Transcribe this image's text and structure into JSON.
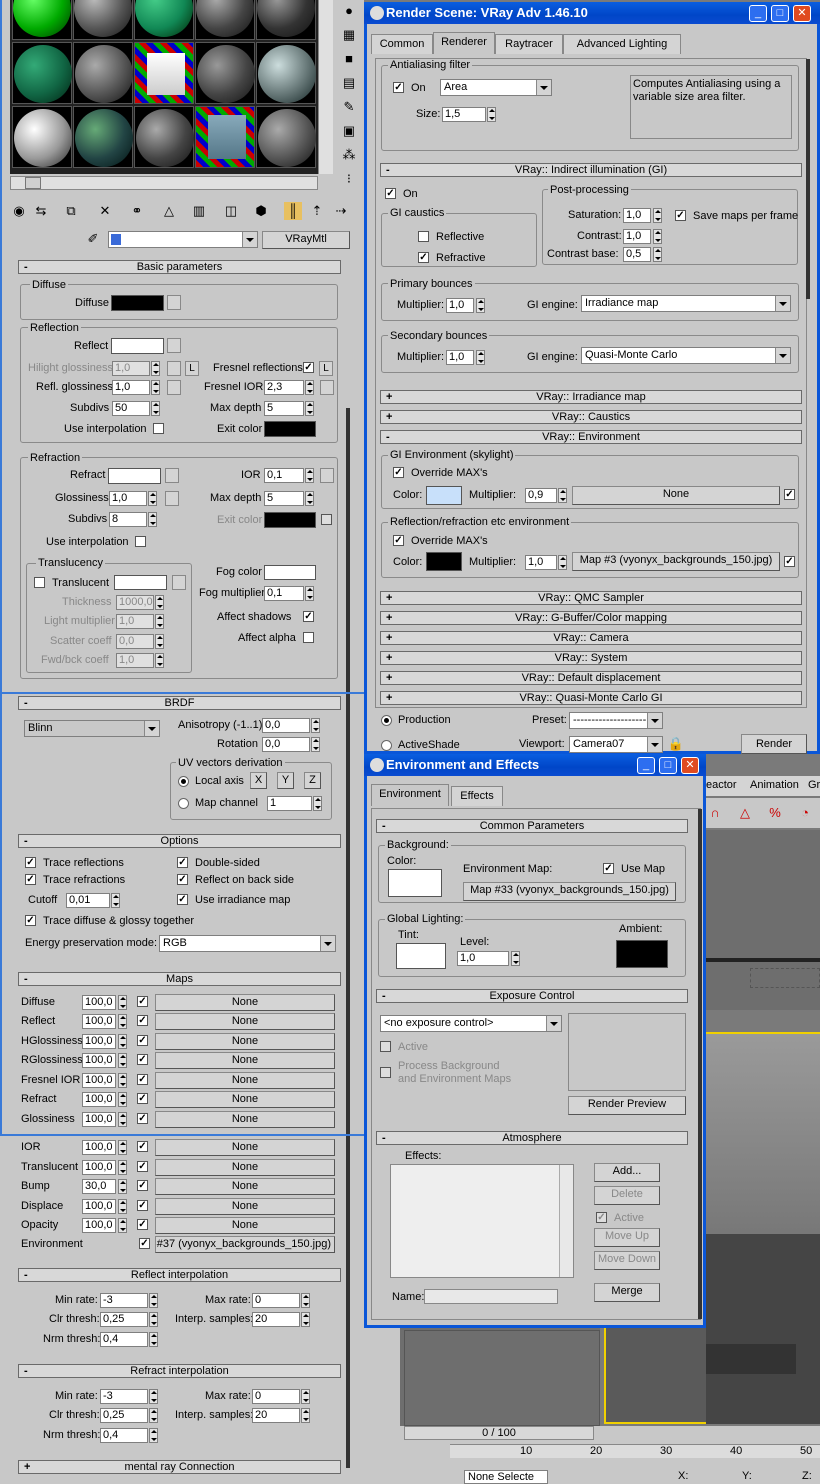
{
  "colors": {
    "panel": "#c8c8c8",
    "titlebar": "#0a56d8",
    "selection_line": "#3a7ad8",
    "viewport": "#6e6e6e"
  },
  "icons": [
    "sphere-icon",
    "checker-icon",
    "cube-icon",
    "color-icon",
    "brush-icon",
    "video-icon",
    "options-icon",
    "select-by-mtl-icon",
    "get-material-icon",
    "put-to-scene-icon",
    "assign-icon",
    "reset-icon",
    "copy-icon",
    "unique-icon",
    "library-icon",
    "id-icon",
    "show-map-icon",
    "show-end-icon",
    "go-parent-icon",
    "go-sibling-icon",
    "pick-icon"
  ],
  "mat_editor": {
    "type_button": "VRayMtl",
    "basic": {
      "title": "Basic parameters",
      "diffuse_group": "Diffuse",
      "diffuse_label": "Diffuse",
      "reflection_group": "Reflection",
      "reflect_label": "Reflect",
      "hilight_label": "Hilight glossiness",
      "hilight_value": "1,0",
      "l_button": "L",
      "fresnel_label": "Fresnel reflections",
      "fresnel_l": "L",
      "refl_gloss_label": "Refl. glossiness",
      "refl_gloss_value": "1,0",
      "fresnel_ior_label": "Fresnel IOR",
      "fresnel_ior_value": "2,3",
      "subdivs_label": "Subdivs",
      "subdivs_value": "50",
      "max_depth_label": "Max depth",
      "max_depth_value": "5",
      "use_interp_label": "Use interpolation",
      "exit_color_label": "Exit color",
      "refraction_group": "Refraction",
      "refract_label": "Refract",
      "ior_label": "IOR",
      "ior_value": "0,1",
      "gloss_label": "Glossiness",
      "gloss_value": "1,0",
      "rmax_depth_label": "Max depth",
      "rmax_depth_value": "5",
      "rsubdivs_label": "Subdivs",
      "rsubdivs_value": "8",
      "rexit_label": "Exit color",
      "ruse_interp_label": "Use interpolation",
      "transl_group": "Translucency",
      "transl_label": "Translucent",
      "thickness_label": "Thickness",
      "thickness_value": "1000,0",
      "light_mult_label": "Light multiplier",
      "light_mult_value": "1,0",
      "scatter_label": "Scatter coeff",
      "scatter_value": "0,0",
      "fwd_label": "Fwd/bck coeff",
      "fwd_value": "1,0",
      "fog_color_label": "Fog color",
      "fog_mult_label": "Fog multiplier",
      "fog_mult_value": "0,1",
      "affect_shadows_label": "Affect shadows",
      "affect_alpha_label": "Affect alpha"
    },
    "brdf": {
      "title": "BRDF",
      "type": "Blinn",
      "aniso_label": "Anisotropy (-1..1)",
      "aniso_value": "0,0",
      "rotation_label": "Rotation",
      "rotation_value": "0,0",
      "uv_group": "UV vectors derivation",
      "local_axis": "Local axis",
      "x": "X",
      "y": "Y",
      "z": "Z",
      "map_channel": "Map channel",
      "map_channel_value": "1"
    },
    "options": {
      "title": "Options",
      "trace_refl": "Trace reflections",
      "double_sided": "Double-sided",
      "trace_refr": "Trace refractions",
      "reflect_back": "Reflect on back side",
      "cutoff_label": "Cutoff",
      "cutoff_value": "0,01",
      "use_irr": "Use irradiance map",
      "trace_diffuse": "Trace diffuse & glossy together",
      "energy_label": "Energy preservation mode:",
      "energy_value": "RGB"
    },
    "maps": {
      "title": "Maps",
      "rows": [
        {
          "name": "Diffuse",
          "amount": "100,0",
          "map": "None"
        },
        {
          "name": "Reflect",
          "amount": "100,0",
          "map": "None"
        },
        {
          "name": "HGlossiness",
          "amount": "100,0",
          "map": "None"
        },
        {
          "name": "RGlossiness",
          "amount": "100,0",
          "map": "None"
        },
        {
          "name": "Fresnel IOR",
          "amount": "100,0",
          "map": "None"
        },
        {
          "name": "Refract",
          "amount": "100,0",
          "map": "None"
        },
        {
          "name": "Glossiness",
          "amount": "100,0",
          "map": "None"
        },
        {
          "name": "IOR",
          "amount": "100,0",
          "map": "None"
        },
        {
          "name": "Translucent",
          "amount": "100,0",
          "map": "None"
        },
        {
          "name": "Bump",
          "amount": "30,0",
          "map": "None"
        },
        {
          "name": "Displace",
          "amount": "100,0",
          "map": "None"
        },
        {
          "name": "Opacity",
          "amount": "100,0",
          "map": "None"
        }
      ],
      "environment_label": "Environment",
      "environment_map": "#37 (vyonyx_backgrounds_150.jpg)"
    },
    "reflect_interp": {
      "title": "Reflect interpolation",
      "min_rate": "Min rate:",
      "min_rate_value": "-3",
      "max_rate": "Max rate:",
      "max_rate_value": "0",
      "clr_thresh": "Clr thresh:",
      "clr_thresh_value": "0,25",
      "interp_samples": "Interp. samples:",
      "interp_samples_value": "20",
      "nrm_thresh": "Nrm thresh:",
      "nrm_thresh_value": "0,4"
    },
    "refract_interp": {
      "title": "Refract interpolation",
      "min_rate": "Min rate:",
      "min_rate_value": "-3",
      "max_rate": "Max rate:",
      "max_rate_value": "0",
      "clr_thresh": "Clr thresh:",
      "clr_thresh_value": "0,25",
      "interp_samples": "Interp. samples:",
      "interp_samples_value": "20",
      "nrm_thresh": "Nrm thresh:",
      "nrm_thresh_value": "0,4"
    },
    "mental_ray": "mental ray Connection"
  },
  "render": {
    "title": "Render Scene: VRay Adv 1.46.10",
    "tabs": [
      "Common",
      "Renderer",
      "Raytracer",
      "Advanced Lighting"
    ],
    "aa": {
      "group": "Antialiasing filter",
      "on": "On",
      "filter": "Area",
      "size_label": "Size:",
      "size_value": "1,5",
      "desc": "Computes Antialiasing using a variable size area filter."
    },
    "gi": {
      "title": "VRay:: Indirect illumination (GI)",
      "on": "On",
      "post": "Post-processing",
      "caustics": "GI caustics",
      "reflective": "Reflective",
      "refractive": "Refractive",
      "saturation": "Saturation:",
      "saturation_value": "1,0",
      "save_maps": "Save maps per frame",
      "contrast": "Contrast:",
      "contrast_value": "1,0",
      "contrast_base": "Contrast base:",
      "contrast_base_value": "0,5",
      "primary": "Primary bounces",
      "multiplier": "Multiplier:",
      "primary_mult": "1,0",
      "gi_engine": "GI engine:",
      "primary_engine": "Irradiance map",
      "secondary": "Secondary bounces",
      "secondary_mult": "1,0",
      "secondary_engine": "Quasi-Monte Carlo"
    },
    "irradiance": "VRay:: Irradiance map",
    "caustics_roll": "VRay:: Caustics",
    "env": {
      "title": "VRay:: Environment",
      "gi_env": "GI Environment (skylight)",
      "override": "Override MAX's",
      "color": "Color:",
      "multiplier": "Multiplier:",
      "gi_mult": "0,9",
      "gi_map": "None",
      "refl_env": "Reflection/refraction etc environment",
      "refl_mult": "1,0",
      "refl_map": "Map #3 (vyonyx_backgrounds_150.jpg)"
    },
    "rollouts": [
      "VRay:: QMC Sampler",
      "VRay:: G-Buffer/Color mapping",
      "VRay:: Camera",
      "VRay:: System",
      "VRay:: Default displacement",
      "VRay:: Quasi-Monte Carlo GI"
    ],
    "production": "Production",
    "preset": "Preset:",
    "preset_value": "--------------------",
    "activeshade": "ActiveShade",
    "viewport": "Viewport:",
    "viewport_value": "Camera07",
    "render_btn": "Render"
  },
  "envfx": {
    "title": "Environment and Effects",
    "tabs": [
      "Environment",
      "Effects"
    ],
    "common": "Common Parameters",
    "background": "Background:",
    "color": "Color:",
    "env_map": "Environment Map:",
    "use_map": "Use Map",
    "map_btn": "Map #33 (vyonyx_backgrounds_150.jpg)",
    "global": "Global Lighting:",
    "tint": "Tint:",
    "level": "Level:",
    "level_value": "1,0",
    "ambient": "Ambient:",
    "exposure": "Exposure Control",
    "exposure_value": "<no exposure control>",
    "active": "Active",
    "process_bg": "Process Background",
    "and_env": "and Environment Maps",
    "render_preview": "Render Preview",
    "atmosphere": "Atmosphere",
    "effects": "Effects:",
    "add": "Add...",
    "delete": "Delete",
    "active2": "Active",
    "move_up": "Move Up",
    "move_down": "Move Down",
    "name": "Name:",
    "merge": "Merge"
  },
  "max_ui": {
    "menu": [
      "eactor",
      "Animation",
      "Gr"
    ],
    "timeline": "0 / 100",
    "ruler": [
      "10",
      "20",
      "30",
      "40",
      "50"
    ],
    "status": "None Selecte",
    "x": "X:",
    "y": "Y:",
    "z": "Z:"
  }
}
